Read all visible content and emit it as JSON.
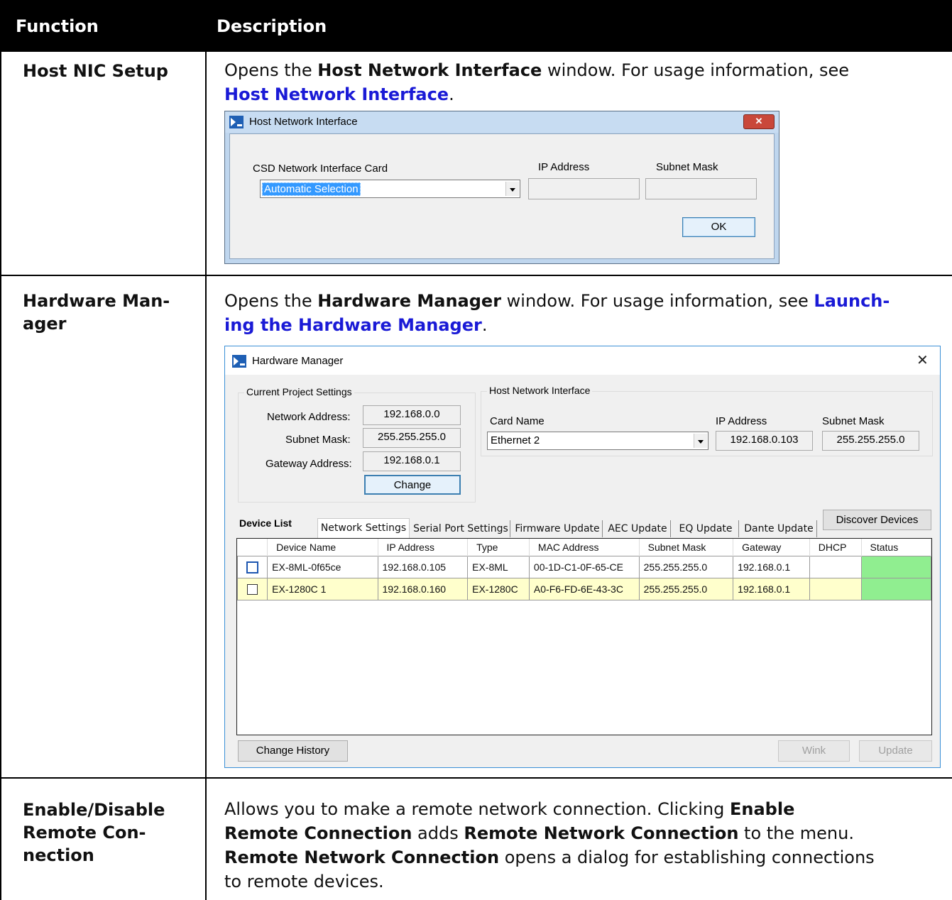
{
  "table": {
    "col_function": "Function",
    "col_description": "Description"
  },
  "rows": [
    {
      "function": "Host NIC Setup",
      "desc": {
        "t1": "Opens the ",
        "b1": "Host Network Interface",
        "t2": " window. For usage information, see ",
        "link": "Host Network Interface",
        "t3": "."
      }
    },
    {
      "function_l1": "Hardware Man-",
      "function_l2": "ager",
      "desc": {
        "t1": "Opens the ",
        "b1": "Hardware Manager",
        "t2": " window. For usage information, see ",
        "link_l1": "Launch-",
        "link_l2": "ing the Hardware Manager",
        "t3": "."
      }
    },
    {
      "function_l1": "Enable/Disable",
      "function_l2": "Remote Con-",
      "function_l3": "nection",
      "desc": {
        "t1": "Allows you to make a remote network connection. Clicking ",
        "b1": "Enable",
        "b2": "Remote Connection",
        "t2": " adds ",
        "b3": "Remote Network Connection",
        "t3": " to the menu.",
        "b4": "Remote Network Connection",
        "t4": " opens a dialog for establishing connections",
        "t5": "to remote devices."
      }
    }
  ],
  "nic_dialog": {
    "title": "Host Network Interface",
    "card_label": "CSD Network Interface Card",
    "card_value": "Automatic Selection",
    "ip_label": "IP Address",
    "subnet_label": "Subnet Mask",
    "ip_value": "",
    "subnet_value": "",
    "ok_label": "OK"
  },
  "hw_dialog": {
    "title": "Hardware Manager",
    "close_glyph": "✕",
    "project": {
      "legend": "Current Project Settings",
      "network_label": "Network Address:",
      "network_value": "192.168.0.0",
      "subnet_label": "Subnet Mask:",
      "subnet_value": "255.255.255.0",
      "gateway_label": "Gateway Address:",
      "gateway_value": "192.168.0.1",
      "change_label": "Change"
    },
    "host": {
      "legend": "Host Network Interface",
      "card_label": "Card Name",
      "card_value": "Ethernet 2",
      "ip_label": "IP Address",
      "ip_value": "192.168.0.103",
      "subnet_label": "Subnet Mask",
      "subnet_value": "255.255.255.0"
    },
    "device_list_label": "Device List",
    "tabs": [
      "Network Settings",
      "Serial Port Settings",
      "Firmware Update",
      "AEC Update",
      "EQ Update",
      "Dante Update"
    ],
    "discover_label": "Discover Devices",
    "columns": [
      "",
      "Device Name",
      "IP Address",
      "Type",
      "MAC Address",
      "Subnet Mask",
      "Gateway",
      "DHCP",
      "Status"
    ],
    "devices": [
      {
        "name": "EX-8ML-0f65ce",
        "ip": "192.168.0.105",
        "type": "EX-8ML",
        "mac": "00-1D-C1-0F-65-CE",
        "subnet": "255.255.255.0",
        "gateway": "192.168.0.1",
        "dhcp": ""
      },
      {
        "name": "EX-1280C 1",
        "ip": "192.168.0.160",
        "type": "EX-1280C",
        "mac": "A0-F6-FD-6E-43-3C",
        "subnet": "255.255.255.0",
        "gateway": "192.168.0.1",
        "dhcp": ""
      }
    ],
    "change_history_label": "Change History",
    "wink_label": "Wink",
    "update_label": "Update",
    "row_colors": [
      "#ffffff",
      "#ffffcc"
    ],
    "status_color": "#90ee90"
  }
}
